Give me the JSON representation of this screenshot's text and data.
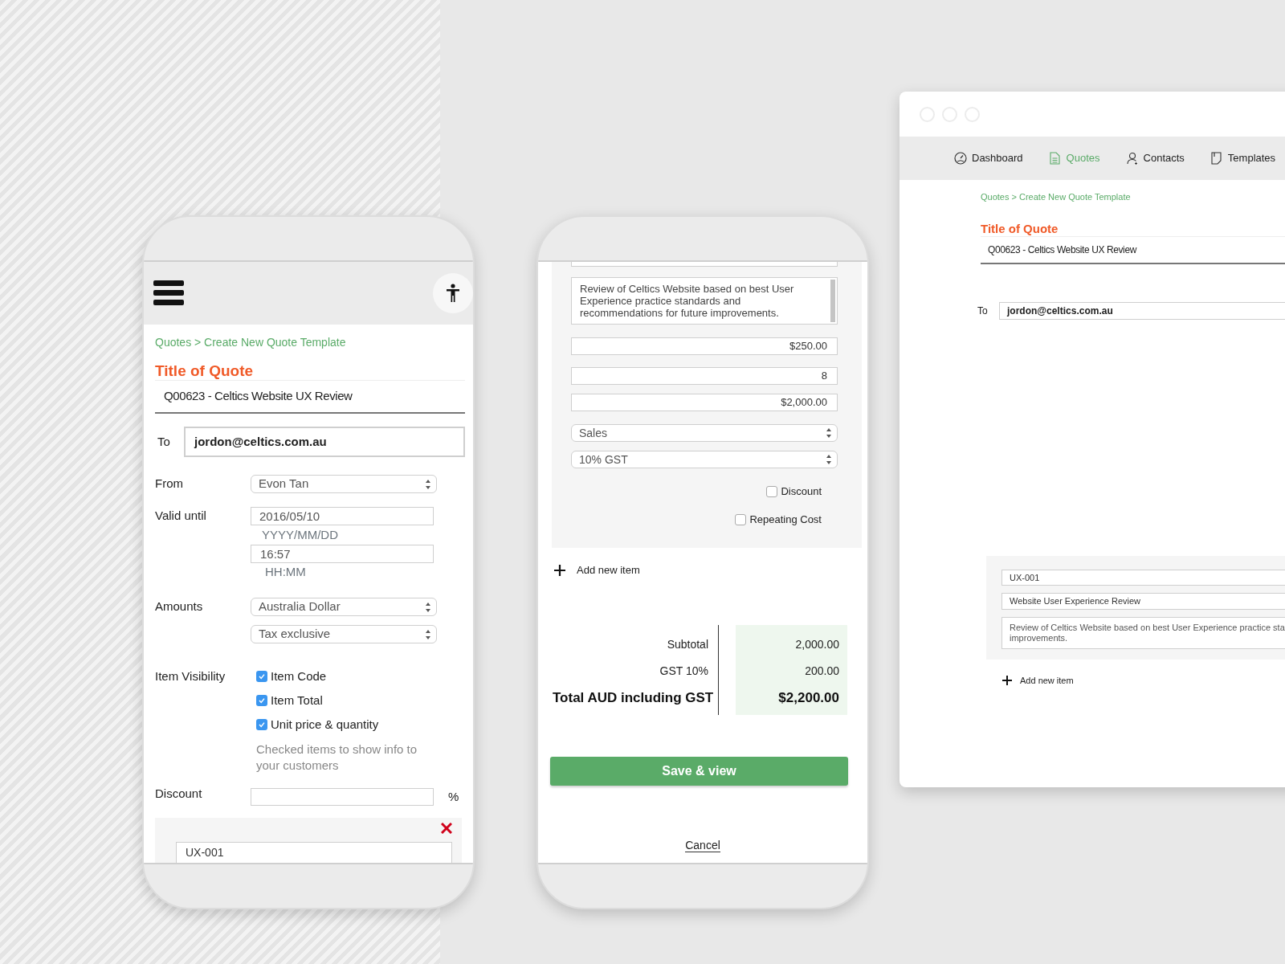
{
  "phone_left": {
    "breadcrumb": "Quotes > Create New Quote Template",
    "title_label": "Title of Quote",
    "title_value": "Q00623 - Celtics Website UX Review",
    "to_label": "To",
    "to_value": "jordon@celtics.com.au",
    "from": {
      "label": "From",
      "value": "Evon Tan"
    },
    "valid_until": {
      "label": "Valid until",
      "date": "2016/05/10",
      "date_format": "YYYY/MM/DD",
      "time": "16:57",
      "time_format": "HH:MM"
    },
    "amounts": {
      "label": "Amounts",
      "currency": "Australia Dollar",
      "tax": "Tax exclusive"
    },
    "item_visibility": {
      "label": "Item Visibility",
      "options": [
        {
          "label": "Item Code",
          "checked": true
        },
        {
          "label": "Item Total",
          "checked": true
        },
        {
          "label": "Unit price & quantity",
          "checked": true
        }
      ],
      "help": "Checked items to show info to your customers"
    },
    "discount": {
      "label": "Discount",
      "unit": "%"
    },
    "item": {
      "code": "UX-001"
    }
  },
  "phone_right": {
    "description": "Review of Celtics Website based on best User Experience practice standards and recommendations for future improvements.",
    "unit_price": "$250.00",
    "quantity": "8",
    "total": "$2,000.00",
    "account": "Sales",
    "tax_rate": "10% GST",
    "options": [
      {
        "label": "Discount",
        "checked": false
      },
      {
        "label": "Repeating Cost",
        "checked": false
      }
    ],
    "add_item": "Add new item",
    "totals": [
      {
        "label": "Subtotal",
        "value": "2,000.00",
        "kind": "regular"
      },
      {
        "label": "GST 10%",
        "value": "200.00",
        "kind": "regular"
      },
      {
        "label": "Total AUD including GST",
        "value": "$2,200.00",
        "kind": "grand"
      }
    ],
    "save_button": "Save & view",
    "cancel": "Cancel"
  },
  "browser": {
    "nav": [
      {
        "label": "Dashboard",
        "selected": false
      },
      {
        "label": "Quotes",
        "selected": true
      },
      {
        "label": "Contacts",
        "selected": false
      },
      {
        "label": "Templates",
        "selected": false
      }
    ],
    "breadcrumb": "Quotes > Create New Quote Template",
    "title_label": "Title of Quote",
    "title_value": "Q00623 - Celtics Website UX Review",
    "to_label": "To",
    "to_value": "jordon@celtics.com.au",
    "item": {
      "code": "UX-001",
      "name": "Website User Experience Review",
      "description_lines": [
        "Review of Celtics Website based on best User Experience practice sta",
        "improvements."
      ]
    },
    "add_item": "Add new item"
  }
}
